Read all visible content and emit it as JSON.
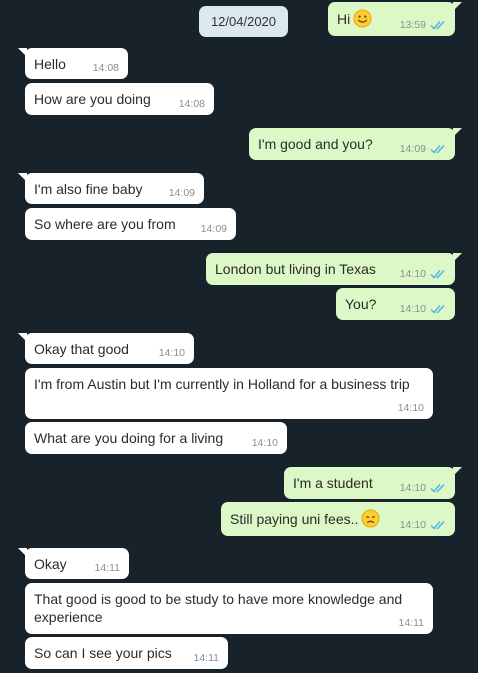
{
  "date_chip": "12/04/2020",
  "messages": [
    {
      "dir": "out",
      "text": "Hi",
      "time": "13:59",
      "emoji": "smiling-face"
    },
    {
      "dir": "in",
      "text": "Hello",
      "time": "14:08"
    },
    {
      "dir": "in",
      "text": "How are you doing",
      "time": "14:08"
    },
    {
      "dir": "out",
      "text": "I'm good and you?",
      "time": "14:09"
    },
    {
      "dir": "in",
      "text": "I'm also fine baby",
      "time": "14:09"
    },
    {
      "dir": "in",
      "text": "So where are you from",
      "time": "14:09"
    },
    {
      "dir": "out",
      "text": "London but living in Texas",
      "time": "14:10"
    },
    {
      "dir": "out",
      "text": "You?",
      "time": "14:10"
    },
    {
      "dir": "in",
      "text": "Okay that good",
      "time": "14:10"
    },
    {
      "dir": "in",
      "text": "I'm from Austin but I'm currently in Holland for a business trip",
      "time": "14:10"
    },
    {
      "dir": "in",
      "text": "What are you doing for a living",
      "time": "14:10"
    },
    {
      "dir": "out",
      "text": "I'm a student",
      "time": "14:10"
    },
    {
      "dir": "out",
      "text": "Still paying uni fees..",
      "time": "14:10",
      "emoji": "disappointed-face"
    },
    {
      "dir": "in",
      "text": "Okay",
      "time": "14:11"
    },
    {
      "dir": "in",
      "text": "That good is good to be study to have more knowledge and experience",
      "time": "14:11"
    },
    {
      "dir": "in",
      "text": "So can I see your pics",
      "time": "14:11"
    }
  ],
  "colors": {
    "background": "#18222a",
    "incoming_bubble": "#ffffff",
    "outgoing_bubble": "#dcf8c6",
    "read_ticks": "#4fb6ec",
    "date_chip": "#dbe9ee"
  },
  "icons": {
    "read_receipt": "double-check-icon",
    "smiling_emoji": "smiling-face-emoji",
    "sad_emoji": "disappointed-face-emoji"
  }
}
